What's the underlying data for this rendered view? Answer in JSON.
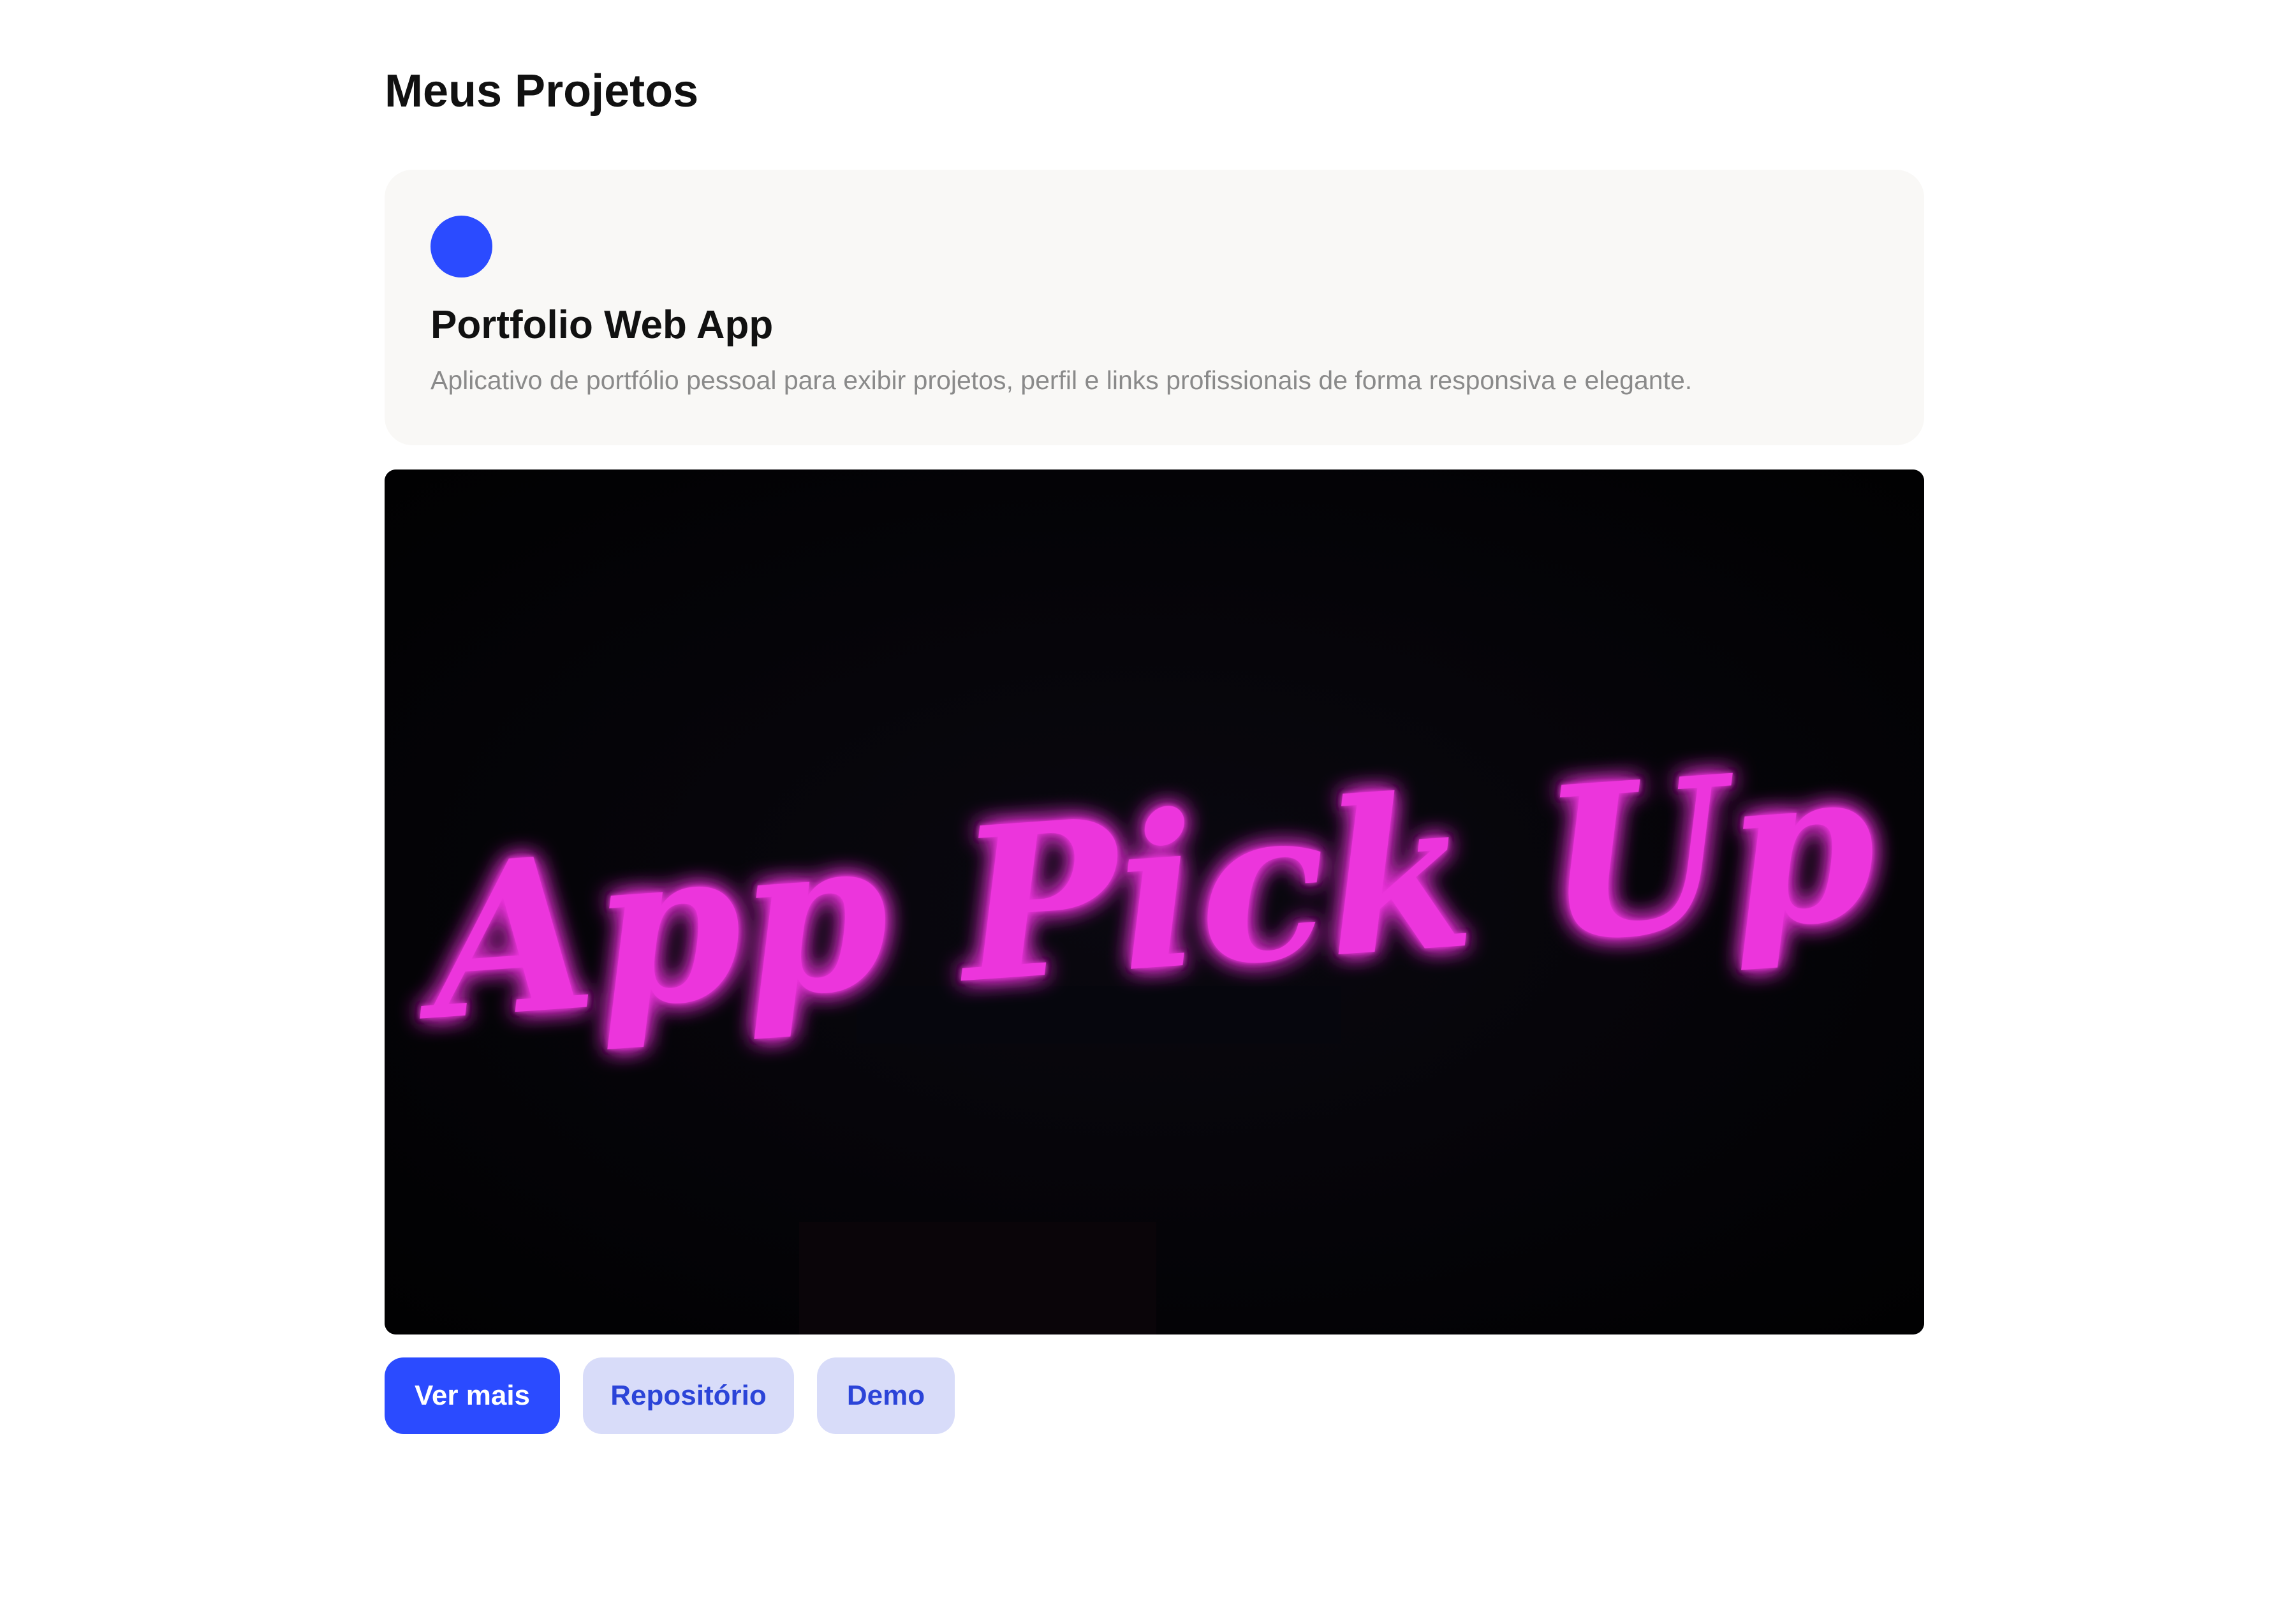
{
  "page": {
    "title": "Meus Projetos"
  },
  "project": {
    "dot_color": "#2b4bff",
    "name": "Portfolio Web App",
    "description": "Aplicativo de portfólio pessoal para exibir projetos, perfil e links profissionais de forma responsiva e elegante.",
    "preview_text": "App Pick Up",
    "preview_text_color": "#e020d0"
  },
  "actions": {
    "primary_label": "Ver mais",
    "repo_label": "Repositório",
    "demo_label": "Demo"
  },
  "colors": {
    "accent": "#2b4bff",
    "secondary_bg": "#d8dcf9",
    "secondary_text": "#2b44d8",
    "card_bg": "#f9f8f6"
  }
}
